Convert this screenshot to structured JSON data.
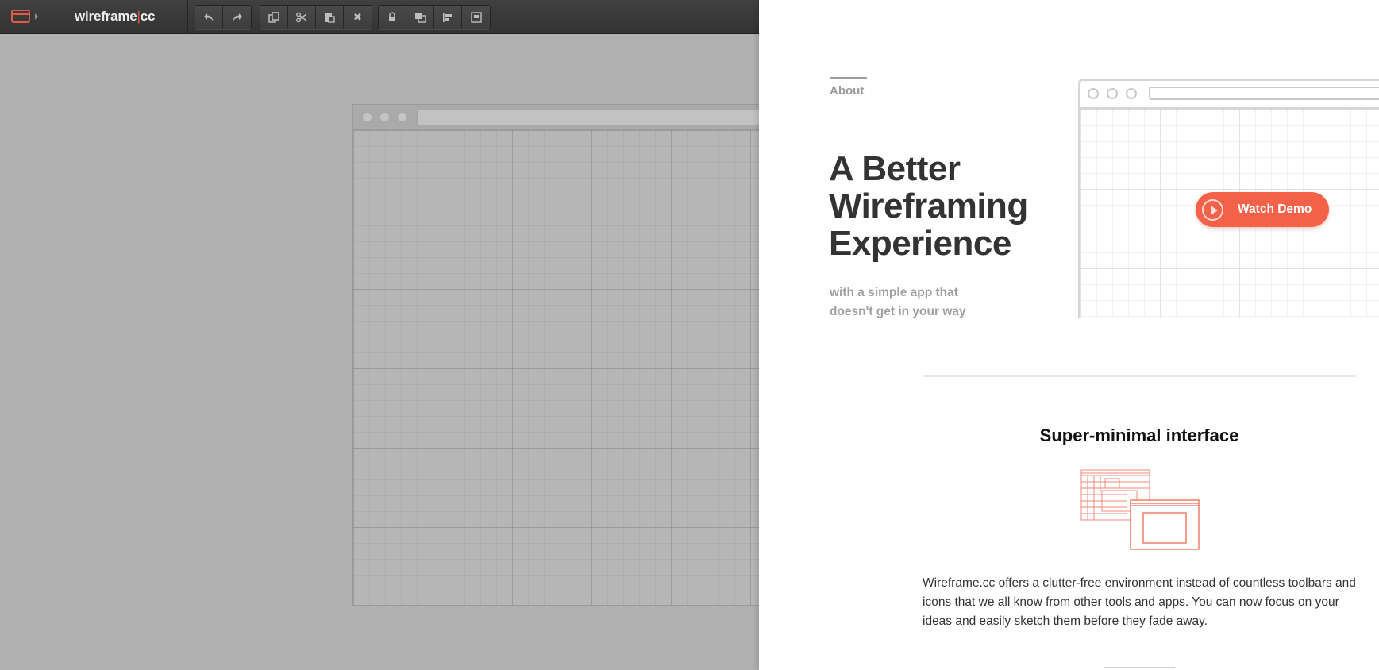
{
  "toolbar": {
    "logo": {
      "prefix": "wireframe",
      "separator": "|",
      "suffix": "cc"
    },
    "icons": {
      "menu": "browser-window-icon",
      "undo": "undo-icon",
      "redo": "redo-icon",
      "copy": "copy-icon",
      "cut": "scissors-icon",
      "paste": "paste-icon",
      "delete": "close-icon",
      "lock": "lock-icon",
      "bring_front": "bring-to-front-icon",
      "align": "align-left-icon",
      "group": "group-icon"
    },
    "delete_glyph": "✖"
  },
  "panel": {
    "about_link": "About",
    "hero": {
      "title_line1": "A Better",
      "title_line2": "Wireframing",
      "title_line3": "Experience",
      "subtitle_line1": "with a simple app that",
      "subtitle_line2": "doesn't get in your way"
    },
    "demo_button": "Watch Demo",
    "feature": {
      "title": "Super-minimal interface",
      "description": "Wireframe.cc offers a clutter-free environment instead of countless toolbars and icons that we all know from other tools and apps. You can now focus on your ideas and easily sketch them before they fade away."
    }
  },
  "colors": {
    "accent": "#e05a47",
    "demo_button": "#f4624a",
    "toolbar_bg": "#383838",
    "canvas_bg": "#b0b0b0",
    "panel_bg": "#ffffff",
    "heading": "#333333",
    "muted": "#a0a0a0"
  }
}
